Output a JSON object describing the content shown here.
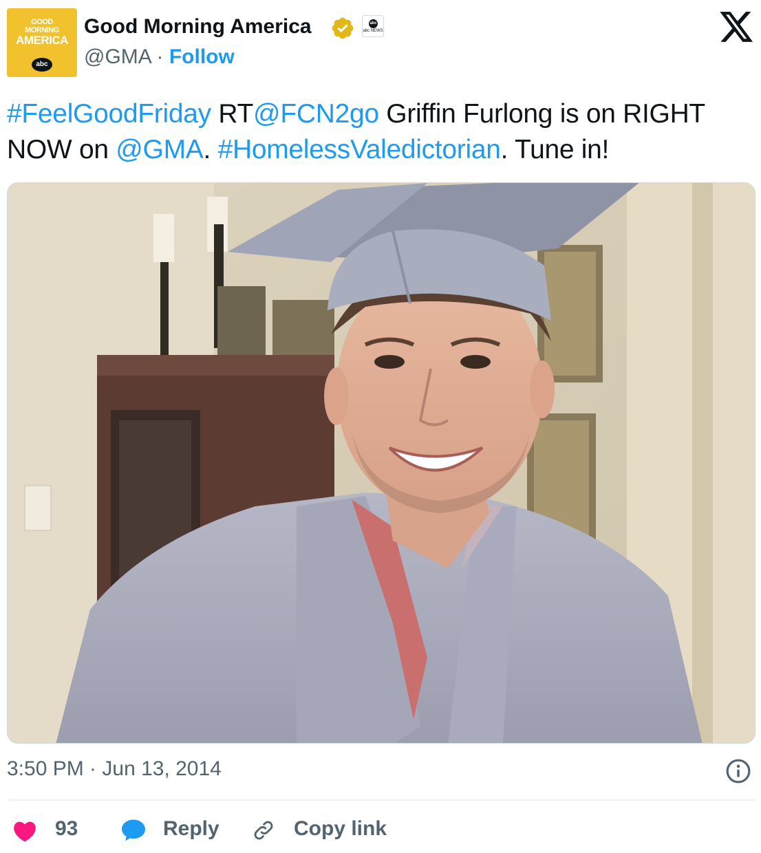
{
  "account": {
    "avatar_text": [
      "GOOD",
      "MORNING",
      "AMERICA"
    ],
    "avatar_badge": "abc",
    "display_name": "Good Morning America",
    "verified_icon": "verified-badge-icon",
    "affiliate_badge": "abc NEWS",
    "handle": "@GMA",
    "separator": "·",
    "follow_label": "Follow"
  },
  "tweet": {
    "segments": [
      {
        "text": "#FeelGoodFriday",
        "link": true
      },
      {
        "text": " RT",
        "link": false
      },
      {
        "text": "@FCN2go",
        "link": true
      },
      {
        "text": " Griffin Furlong is on RIGHT NOW on ",
        "link": false
      },
      {
        "text": "@GMA",
        "link": true
      },
      {
        "text": ". ",
        "link": false
      },
      {
        "text": "#HomelessValedictorian",
        "link": true
      },
      {
        "text": ". Tune in!",
        "link": false
      }
    ],
    "timestamp": "3:50 PM · Jun 13, 2014"
  },
  "actions": {
    "like_count": "93",
    "reply_label": "Reply",
    "copy_link_label": "Copy link"
  },
  "colors": {
    "link": "#1d9bf0",
    "text": "#0f1419",
    "secondary": "#536471",
    "like": "#f91880",
    "avatar_bg": "#f2c12e",
    "verified": "#e2b719"
  },
  "icons": [
    "x-logo-icon",
    "verified-badge-icon",
    "info-icon",
    "heart-icon",
    "reply-bubble-icon",
    "link-icon"
  ]
}
